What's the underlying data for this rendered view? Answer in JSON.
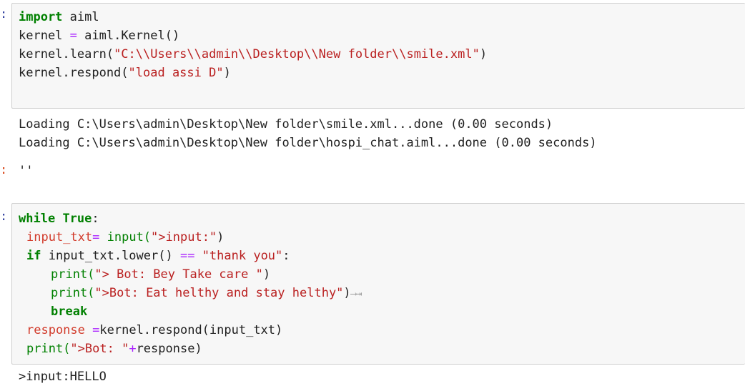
{
  "cells": [
    {
      "prompt": ":",
      "code": {
        "l1_kw": "import",
        "l1_rest": " aiml",
        "l2_a": "kernel ",
        "l2_op": "=",
        "l2_b": " aiml.Kernel()",
        "l3_a": "kernel.learn(",
        "l3_str": "\"C:\\\\Users\\\\admin\\\\Desktop\\\\New folder\\\\smile.xml\"",
        "l3_b": ")",
        "l4_a": "kernel.respond(",
        "l4_str": "\"load assi D\"",
        "l4_b": ")"
      },
      "stdout": [
        "Loading C:\\Users\\admin\\Desktop\\New folder\\smile.xml...done (0.00 seconds)",
        "Loading C:\\Users\\admin\\Desktop\\New folder\\hospi_chat.aiml...done (0.00 seconds)"
      ],
      "out_prompt": ":",
      "result": "''"
    },
    {
      "prompt": ":",
      "code": {
        "l1_kw": "while",
        "l1_sp": " ",
        "l1_kw2": "True",
        "l1_rest": ":",
        "l2_var": "input_txt",
        "l2_op": "=",
        "l2_sp": " ",
        "l2_fn": "input(",
        "l2_str": "\">input:\"",
        "l2_end": ")",
        "l3_kw": "if",
        "l3_a": " input_txt.lower() ",
        "l3_op": "==",
        "l3_sp": " ",
        "l3_str": "\"thank you\"",
        "l3_end": ":",
        "l4_fn": "print(",
        "l4_str": "\"> Bot: Bey Take care \"",
        "l4_end": ")",
        "l5_fn": "print(",
        "l5_str": "\">Bot: Eat helthy and stay helthy\"",
        "l5_end": ")",
        "l5_arrow": "⟶⇥",
        "l6_kw": "break",
        "l7_var": "response",
        "l7_sp": " ",
        "l7_op": "=",
        "l7_rest": "kernel.respond(input_txt)",
        "l8_fn": "print(",
        "l8_str": "\">Bot: \"",
        "l8_op": "+",
        "l8_rest": "response)"
      },
      "stdout_partial": ">input:HELLO"
    }
  ]
}
